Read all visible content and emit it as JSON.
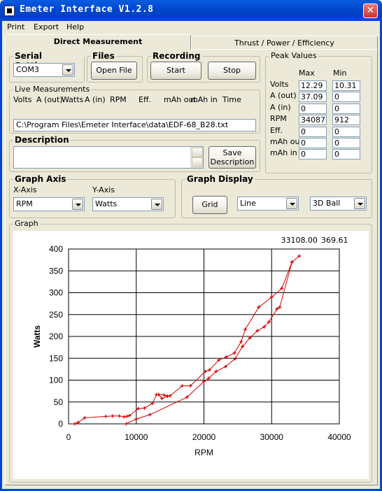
{
  "window": {
    "title": "Emeter Interface V1.2.8",
    "close_glyph": "✕"
  },
  "menu": [
    "Print",
    "Export",
    "Help"
  ],
  "tabs": [
    {
      "label": "Direct Measurement"
    },
    {
      "label": "Thrust / Power / Efficiency"
    }
  ],
  "serial": {
    "title": "Serial Settings",
    "port": "COM3"
  },
  "files": {
    "title": "Files",
    "open_label": "Open File"
  },
  "recording": {
    "title": "Recording",
    "start_label": "Start",
    "stop_label": "Stop"
  },
  "peak": {
    "title": "Peak Values",
    "max_header": "Max",
    "min_header": "Min",
    "rows": [
      {
        "label": "Volts",
        "max": "12.29",
        "min": "10.31"
      },
      {
        "label": "A (out)",
        "max": "37.09",
        "min": "0"
      },
      {
        "label": "A (in)",
        "max": "0",
        "min": "0"
      },
      {
        "label": "RPM",
        "max": "34087",
        "min": "912"
      },
      {
        "label": "Eff.",
        "max": "0",
        "min": "0"
      },
      {
        "label": "mAh out",
        "max": "0",
        "min": "0"
      },
      {
        "label": "mAh in",
        "max": "0",
        "min": "0"
      }
    ]
  },
  "live": {
    "title": "Live Measurements",
    "headers": [
      "Volts",
      "A (out)",
      "Watts",
      "A (in)",
      "RPM",
      "Eff.",
      "mAh out",
      "mAh in",
      "Time"
    ],
    "file_path": "C:\\Program Files\\Emeter Interface\\data\\EDF-68_B28.txt"
  },
  "description": {
    "title": "Description",
    "value": "",
    "save_line1": "Save",
    "save_line2": "Description"
  },
  "graph_axis": {
    "title": "Graph Axis",
    "x_label": "X-Axis",
    "x_value": "RPM",
    "y_label": "Y-Axis",
    "y_value": "Watts"
  },
  "graph_display": {
    "title": "Graph Display",
    "grid_label": "Grid",
    "style_value": "Line",
    "marker_value": "3D Ball"
  },
  "graph": {
    "title": "Graph",
    "cursor_x": "33108.00",
    "cursor_y": "369.61"
  },
  "chart_data": {
    "type": "line",
    "xlabel": "RPM",
    "ylabel": "Watts",
    "xlim": [
      0,
      40000
    ],
    "ylim": [
      0,
      400
    ],
    "xticks": [
      0,
      10000,
      20000,
      30000,
      40000
    ],
    "yticks": [
      0,
      50,
      100,
      150,
      200,
      250,
      300,
      350,
      400
    ],
    "grid": true,
    "series": [
      {
        "color": "#d40000",
        "marker": "cross",
        "points": [
          [
            912,
            0
          ],
          [
            1400,
            3
          ],
          [
            2400,
            14
          ],
          [
            5500,
            17
          ],
          [
            6500,
            18
          ],
          [
            7500,
            18
          ],
          [
            8200,
            16
          ],
          [
            8600,
            17
          ],
          [
            9000,
            19
          ],
          [
            10300,
            35
          ],
          [
            11200,
            36
          ],
          [
            12400,
            47
          ],
          [
            13000,
            67
          ],
          [
            14100,
            66
          ],
          [
            14600,
            63
          ],
          [
            13800,
            58
          ],
          [
            13300,
            67
          ],
          [
            15000,
            64
          ],
          [
            16800,
            87
          ],
          [
            18000,
            87
          ],
          [
            20200,
            120
          ],
          [
            20800,
            123
          ],
          [
            22200,
            146
          ],
          [
            23300,
            153
          ],
          [
            24500,
            162
          ],
          [
            25500,
            188
          ],
          [
            26100,
            216
          ],
          [
            28100,
            267
          ],
          [
            30000,
            290
          ],
          [
            31500,
            310
          ],
          [
            33000,
            370
          ],
          [
            34087,
            384
          ],
          [
            33000,
            370
          ],
          [
            31200,
            267
          ],
          [
            30800,
            263
          ],
          [
            29600,
            233
          ],
          [
            28900,
            222
          ],
          [
            27900,
            213
          ],
          [
            26800,
            197
          ],
          [
            25700,
            177
          ],
          [
            24600,
            149
          ],
          [
            23200,
            131
          ],
          [
            21800,
            120
          ],
          [
            20700,
            104
          ],
          [
            20000,
            97
          ],
          [
            17500,
            61
          ],
          [
            12000,
            21
          ],
          [
            10000,
            11
          ],
          [
            8500,
            0
          ]
        ]
      }
    ]
  }
}
